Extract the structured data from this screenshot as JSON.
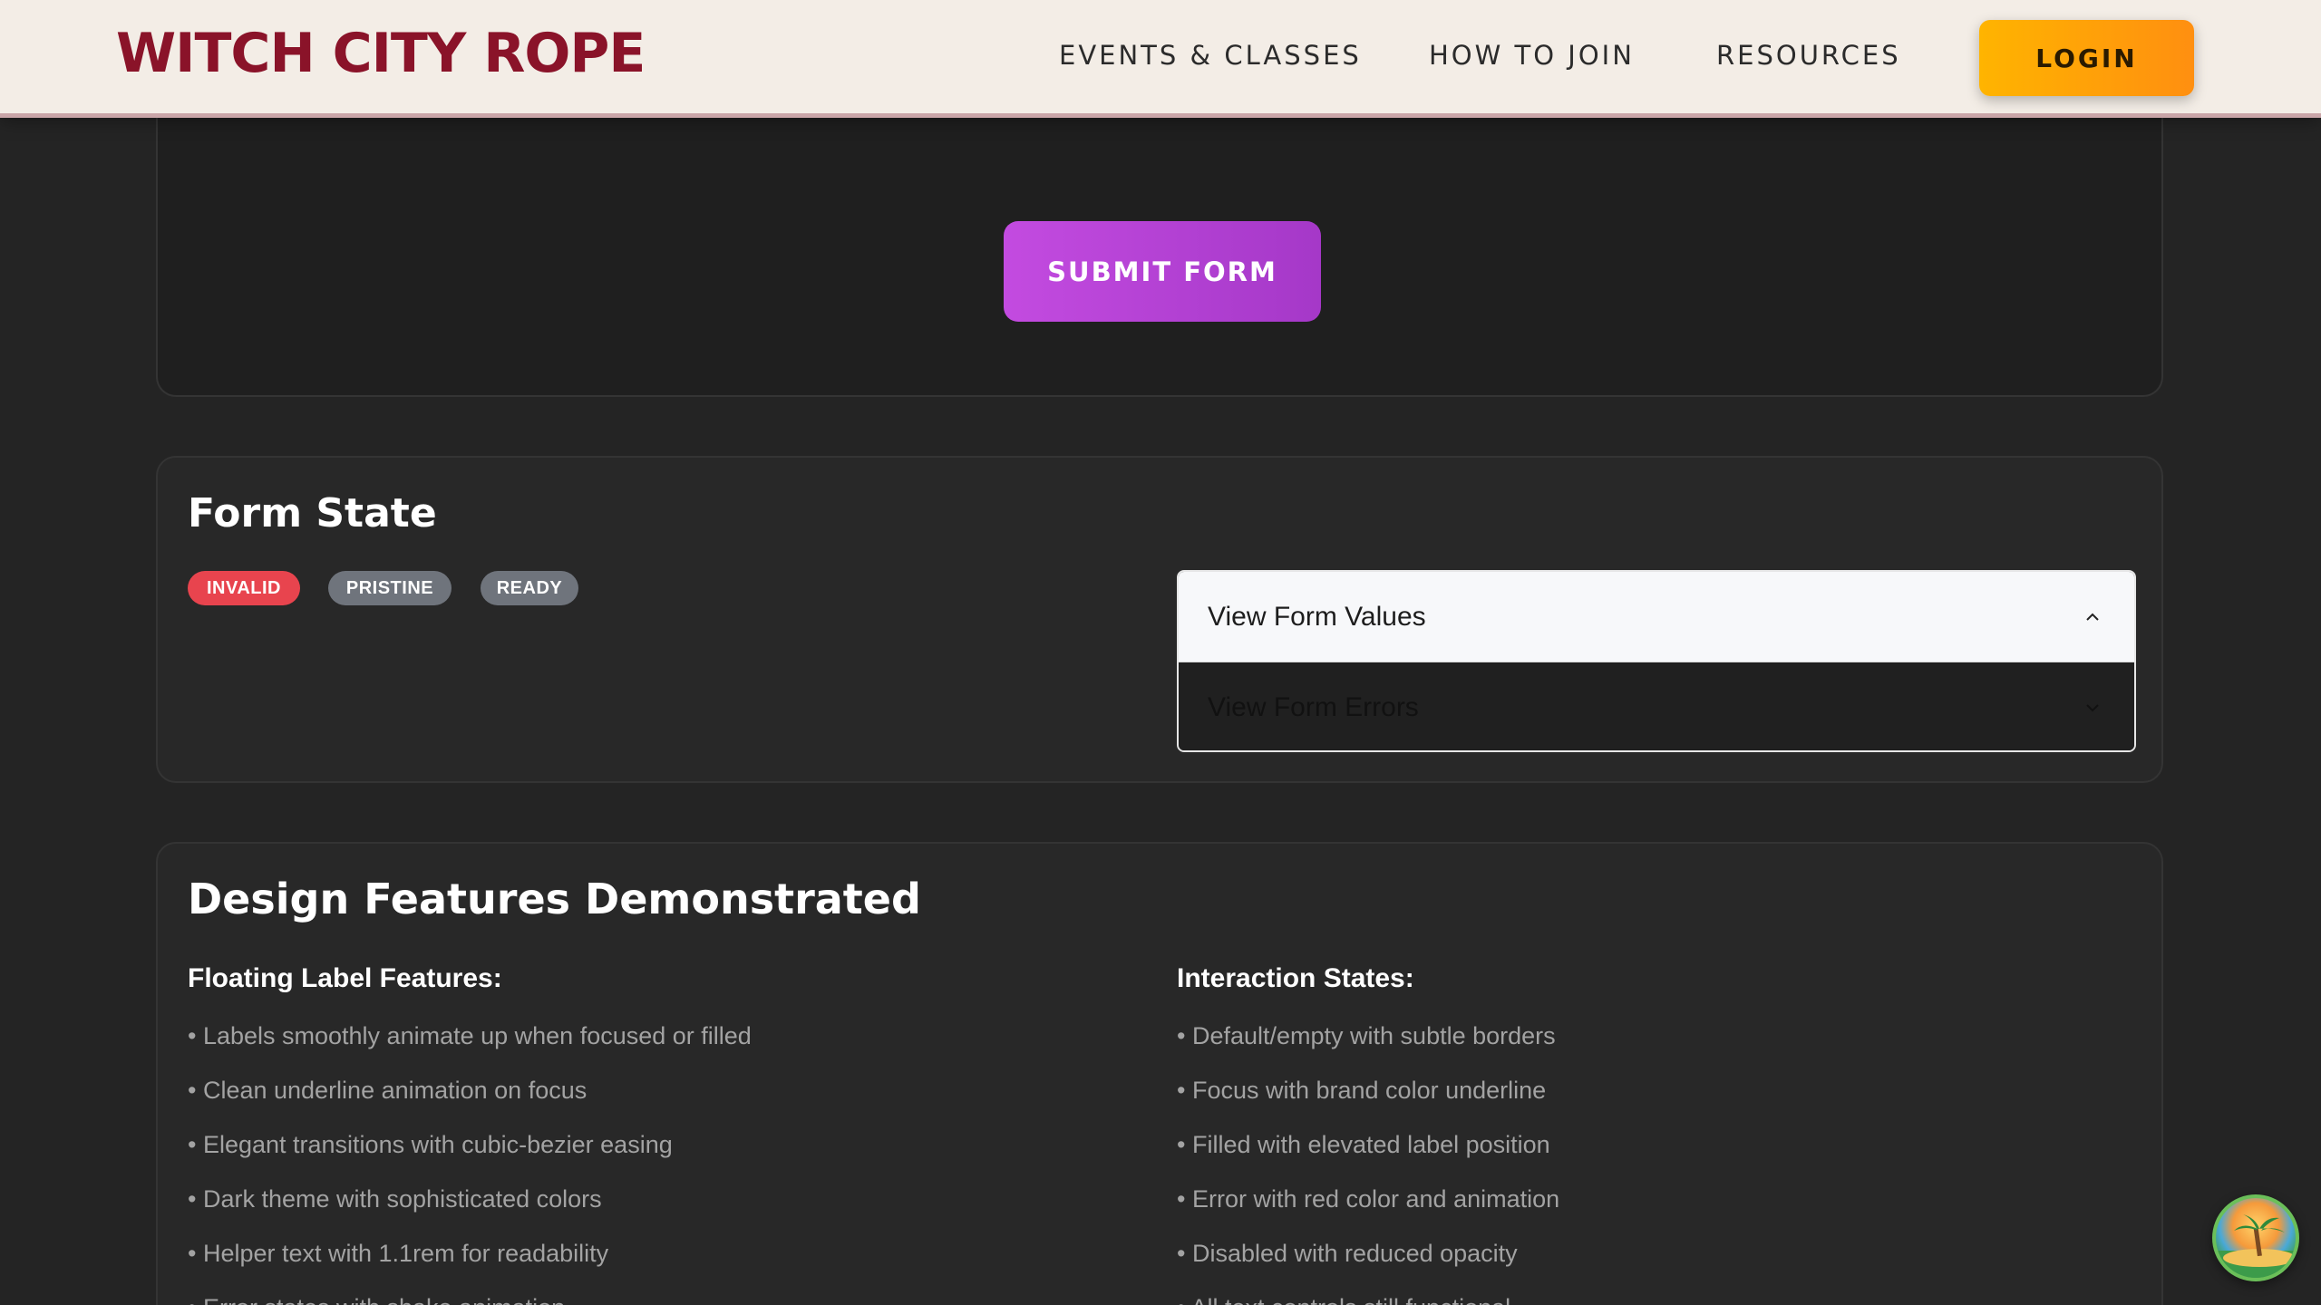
{
  "header": {
    "logo": "WITCH CITY ROPE",
    "nav": {
      "events": "EVENTS & CLASSES",
      "join": "HOW TO JOIN",
      "resources": "RESOURCES"
    },
    "login_label": "LOGIN"
  },
  "submit_section": {
    "submit_label": "SUBMIT FORM"
  },
  "form_state": {
    "title": "Form State",
    "badges": [
      "INVALID",
      "PRISTINE",
      "READY"
    ],
    "accordion": {
      "values_label": "View Form Values",
      "errors_label": "View Form Errors"
    }
  },
  "features": {
    "title": "Design Features Demonstrated",
    "left_heading": "Floating Label Features:",
    "left_items": [
      "• Labels smoothly animate up when focused or filled",
      "• Clean underline animation on focus",
      "• Elegant transitions with cubic-bezier easing",
      "• Dark theme with sophisticated colors",
      "• Helper text with 1.1rem for readability",
      "• Error states with shake animation"
    ],
    "right_heading": "Interaction States:",
    "right_items": [
      "• Default/empty with subtle borders",
      "• Focus with brand color underline",
      "• Filled with elevated label position",
      "• Error with red color and animation",
      "• Disabled with reduced opacity",
      "• All text controls still functional"
    ]
  },
  "colors": {
    "brand": "#8a1329",
    "login_accent": "#ffb400",
    "submit_accent": "#b842d4",
    "invalid_badge": "#e8444e",
    "neutral_badge": "#6f747c"
  }
}
